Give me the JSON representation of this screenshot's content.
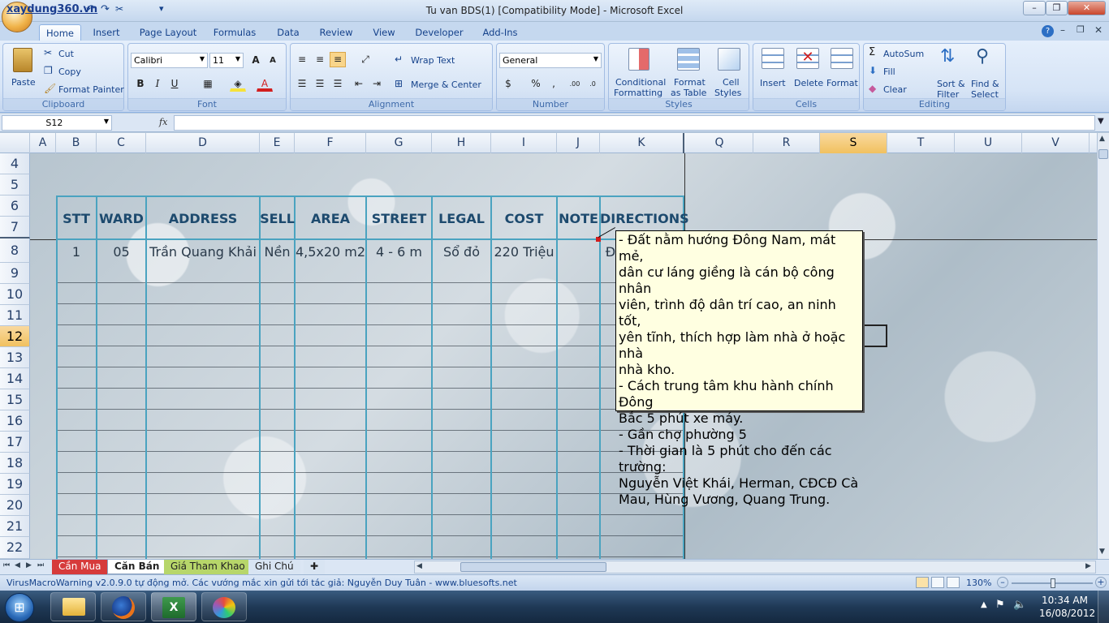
{
  "window": {
    "title": "Tu van BDS(1)  [Compatibility Mode] - Microsoft Excel",
    "watermark": "xaydung360.vn"
  },
  "ribbon_tabs": [
    "Home",
    "Insert",
    "Page Layout",
    "Formulas",
    "Data",
    "Review",
    "View",
    "Developer",
    "Add-Ins"
  ],
  "clipboard": {
    "paste": "Paste",
    "cut": "Cut",
    "copy": "Copy",
    "format_painter": "Format Painter",
    "label": "Clipboard"
  },
  "font": {
    "name": "Calibri",
    "size": "11",
    "label": "Font"
  },
  "alignment": {
    "wrap": "Wrap Text",
    "merge": "Merge & Center",
    "label": "Alignment"
  },
  "number": {
    "format": "General",
    "label": "Number"
  },
  "styles": {
    "cond1": "Conditional",
    "cond2": "Formatting",
    "fmt1": "Format",
    "fmt2": "as Table",
    "cell1": "Cell",
    "cell2": "Styles",
    "label": "Styles"
  },
  "cells": {
    "insert": "Insert",
    "delete": "Delete",
    "format": "Format",
    "label": "Cells"
  },
  "editing": {
    "autosum": "AutoSum",
    "fill": "Fill",
    "clear": "Clear",
    "sort1": "Sort &",
    "sort2": "Filter",
    "find1": "Find &",
    "find2": "Select",
    "label": "Editing"
  },
  "formula_bar": {
    "name_box": "S12",
    "fx": "fx",
    "value": ""
  },
  "columns": [
    "A",
    "B",
    "C",
    "D",
    "E",
    "F",
    "G",
    "H",
    "I",
    "J",
    "K",
    "Q",
    "R",
    "S",
    "T",
    "U",
    "V"
  ],
  "rows": [
    "4",
    "5",
    "6",
    "7",
    "8",
    "9",
    "10",
    "11",
    "12",
    "13",
    "14",
    "15",
    "16",
    "17",
    "18",
    "19",
    "20",
    "21",
    "22"
  ],
  "table": {
    "headers": [
      "STT",
      "WARD",
      "ADDRESS",
      "SELL",
      "AREA",
      "STREET",
      "LEGAL",
      "COST",
      "NOTE",
      "DIRECTIONS"
    ],
    "row1": [
      "1",
      "05",
      "Trần Quang Khải",
      "Nền",
      "4,5x20 m2",
      "4 - 6 m",
      "Sổ đỏ",
      "220 Triệu",
      "",
      "Đ"
    ]
  },
  "comment": [
    "- Đất nằm hướng Đông Nam, mát mẻ,",
    "dân cư láng giềng là cán bộ công nhân",
    "viên, trình độ dân trí cao, an ninh tốt,",
    "yên tĩnh, thích hợp làm nhà ở hoặc nhà",
    "nhà kho.",
    "- Cách trung tâm khu hành chính Đông",
    "Bắc 5 phút xe máy.",
    "- Gần chợ phường 5",
    "- Thời gian là 5 phút cho đến các trường:",
    "Nguyễn Việt Khái, Herman, CĐCĐ Cà",
    "Mau, Hùng Vương, Quang Trung."
  ],
  "sheet_tabs": [
    "Cần Mua",
    "Căn Bán",
    "Giá Tham Khao",
    "Ghi Chú"
  ],
  "status": {
    "text": "VirusMacroWarning v2.0.9.0 tự động mở. Các vướng mắc xin gửi tới tác giả: Nguyễn Duy Tuân - www.bluesofts.net",
    "zoom": "130%"
  },
  "clock": {
    "time": "10:34 AM",
    "date": "16/08/2012"
  },
  "colors": {
    "table_border": "#4aa3c0",
    "selected_header": "#f1c15f",
    "comment_bg": "#ffffe1"
  }
}
